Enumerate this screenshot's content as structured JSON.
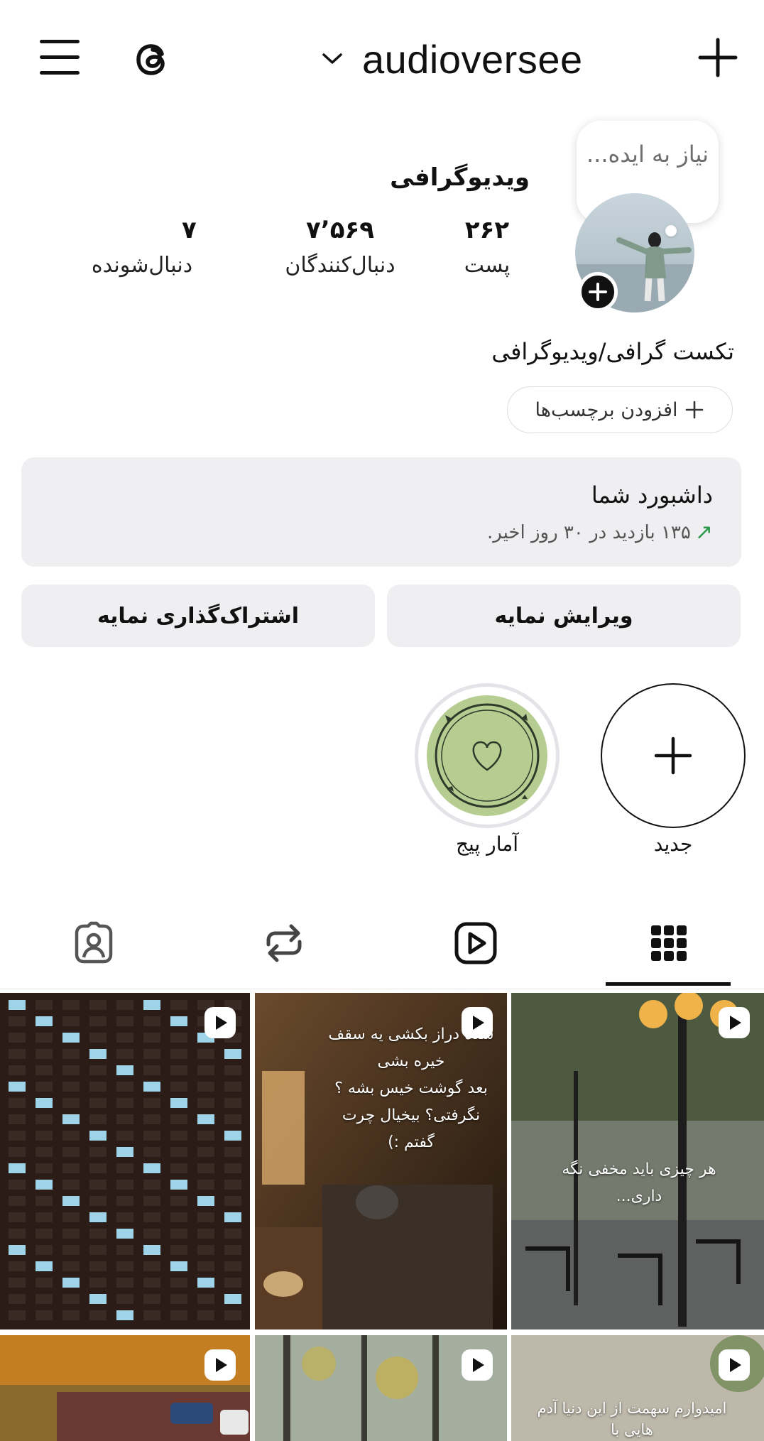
{
  "header": {
    "username": "audioversee",
    "icons": [
      "menu-icon",
      "threads-icon",
      "chevron-down-icon",
      "plus-icon"
    ]
  },
  "note": {
    "text": "نیاز به ایده..."
  },
  "profile": {
    "display_name": "ویدیوگرافی",
    "bio": "تکست گرافی/ویدیوگرافی",
    "stats": {
      "posts_value": "۲۶۲",
      "posts_label": "پست",
      "followers_value": "۷٬۵۶۹",
      "followers_label": "دنبال‌کنندگان",
      "following_value": "۷",
      "following_label": "دنبال‌شونده"
    },
    "add_tags_label": "افزودن برچسب‌ها"
  },
  "dashboard": {
    "title": "داشبورد شما",
    "subtitle": "۱۳۵ بازدید در ۳۰ روز اخیر."
  },
  "actions": {
    "edit_label": "ویرایش نمایه",
    "share_label": "اشتراک‌گذاری نمایه"
  },
  "highlights": [
    {
      "label": "جدید"
    },
    {
      "label": "آمار پیج"
    }
  ],
  "tabs": [
    "grid-icon",
    "reels-icon",
    "reposts-icon",
    "tagged-icon"
  ],
  "grid": {
    "tile2_text": "شده دراز بکشی یه سقف خیره بشی\nبعد گوشت خیس بشه ؟\nنگرفتی؟ بیخیال چرت گفتم :)",
    "tile3_text": "هر چیزی باید مخفی نگه داری...",
    "tile6_text": "امیدوارم سهمت از این دنیا آدم هایی با\nنیت پاک باشد"
  },
  "colors": {
    "button_bg": "#efeff2",
    "dashboard_arrow": "#2a9a4a",
    "highlight_fill": "#b6cd92"
  }
}
